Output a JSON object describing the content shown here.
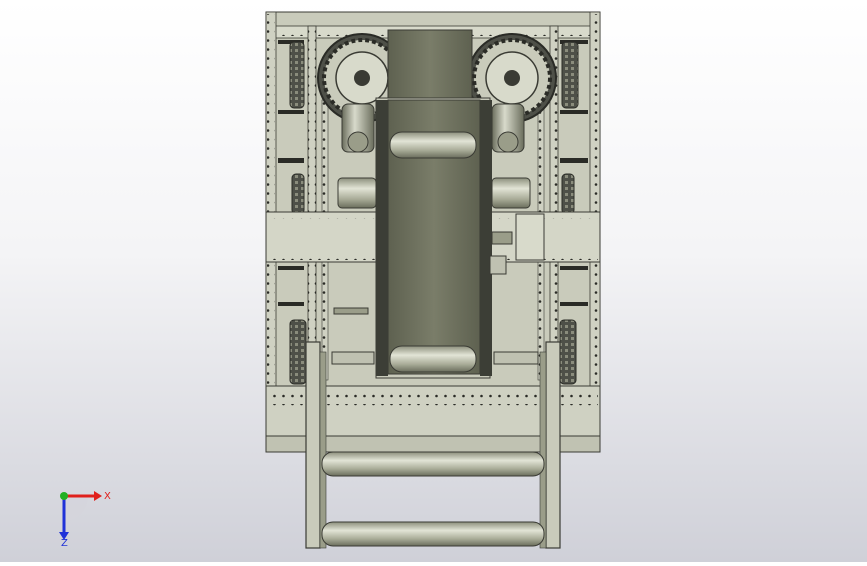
{
  "viewport": {
    "background_top": "#ffffff",
    "background_bottom": "#cfd0d8",
    "model": {
      "frame_color": "#c9cbbb",
      "panel_color": "#d4d6c7",
      "rail_color": "#3c3e36",
      "belt_color": "#6f725f",
      "roller_color": "#a9ac98",
      "gear_color": "#4e5048",
      "bolt_color": "#2a2b26"
    }
  },
  "triad": {
    "x_label": "X",
    "z_label": "Z",
    "x_color": "#e0201c",
    "y_color": "#22b022",
    "z_color": "#2032d8"
  }
}
